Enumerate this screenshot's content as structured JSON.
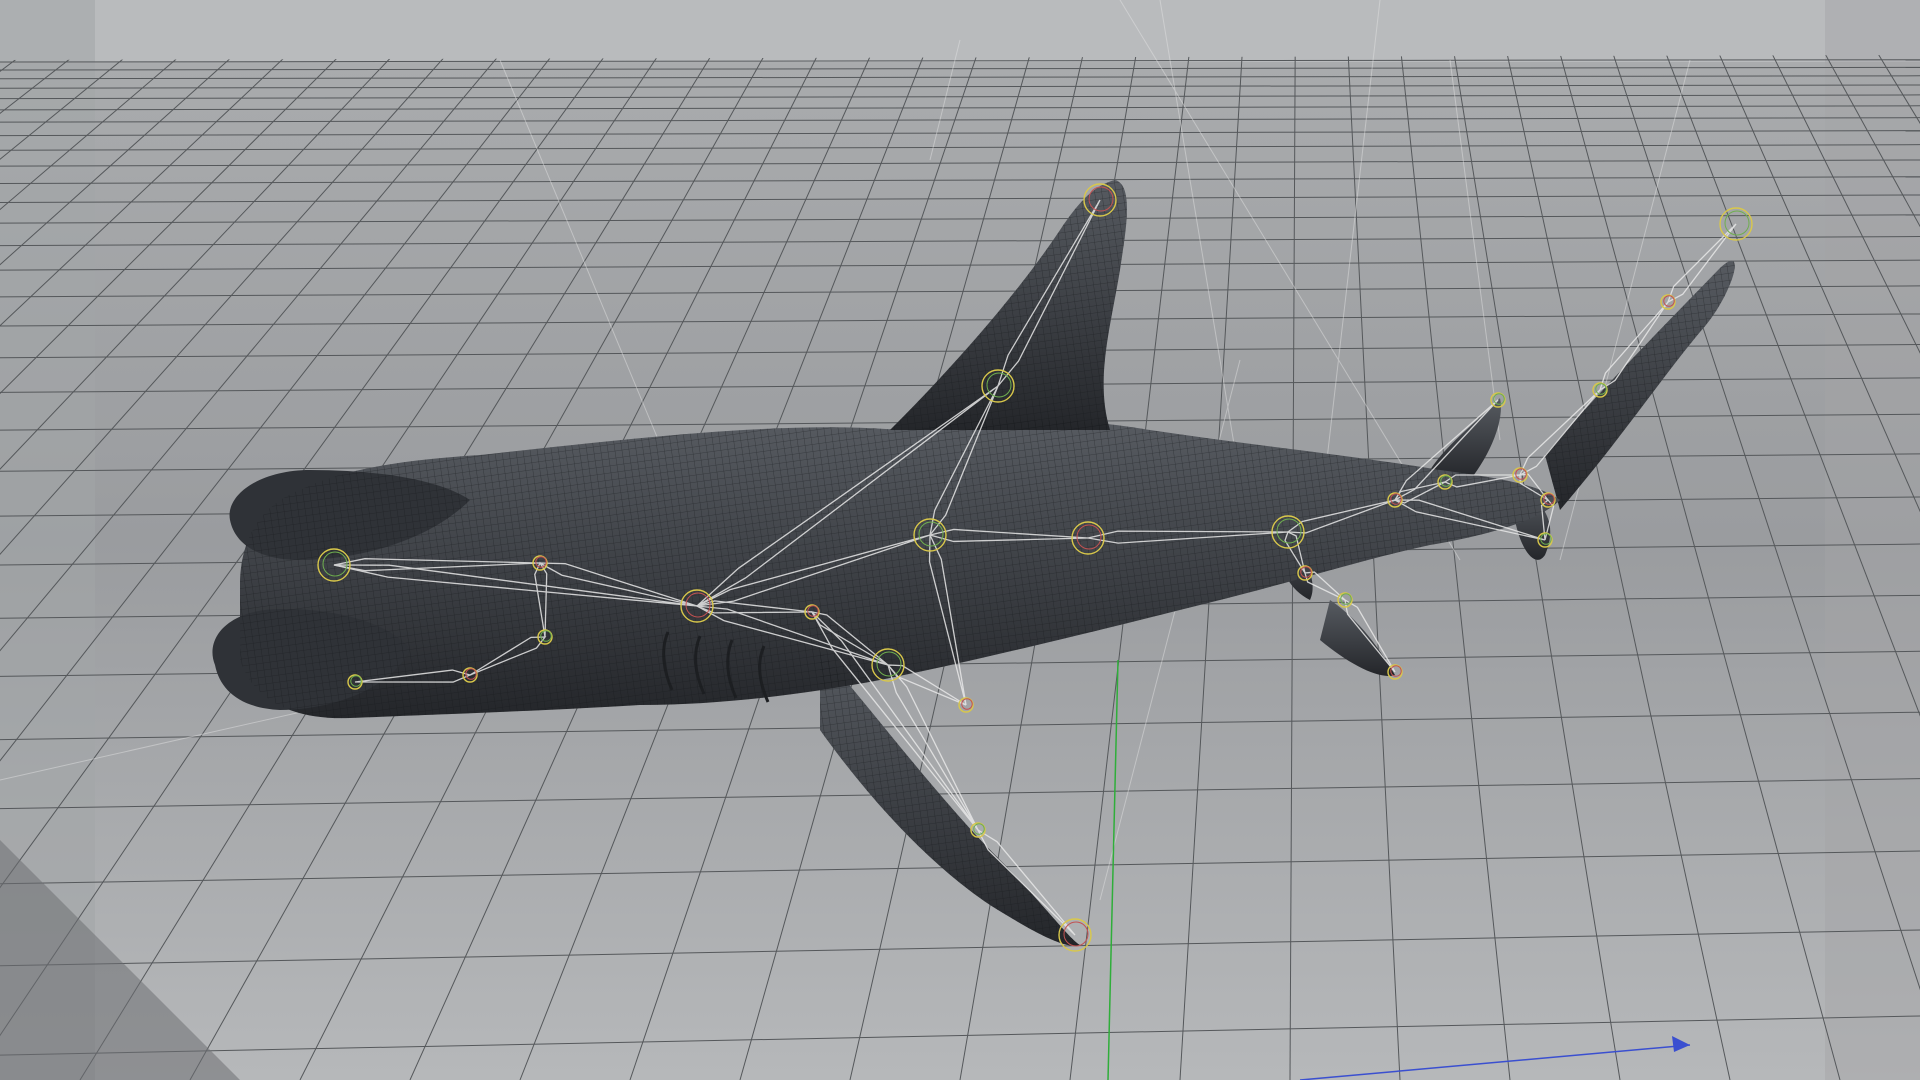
{
  "viewport": {
    "name": "3d-perspective-viewport",
    "background_colors": {
      "top": "#bfc1c3",
      "horizon": "#9ea0a3",
      "bottom": "#b5b7b9"
    },
    "grid": {
      "shown": true,
      "line_color": "#5e6063",
      "floor_color": "#a8aaac"
    },
    "axis_colors": {
      "y_axis": "#2fae3a",
      "x_axis": "#3a4fd0"
    }
  },
  "scene": {
    "object": {
      "kind": "shark-mesh",
      "display_mode": "wireframe-on-shaded",
      "mesh_color": "#3a3d42",
      "wire_color": "#16181b"
    },
    "skeleton": {
      "shown": true,
      "bone_color": "#e8e8e8",
      "joint_ring_colors": [
        "#d9c84a",
        "#6fae4f",
        "#c25252"
      ]
    }
  }
}
